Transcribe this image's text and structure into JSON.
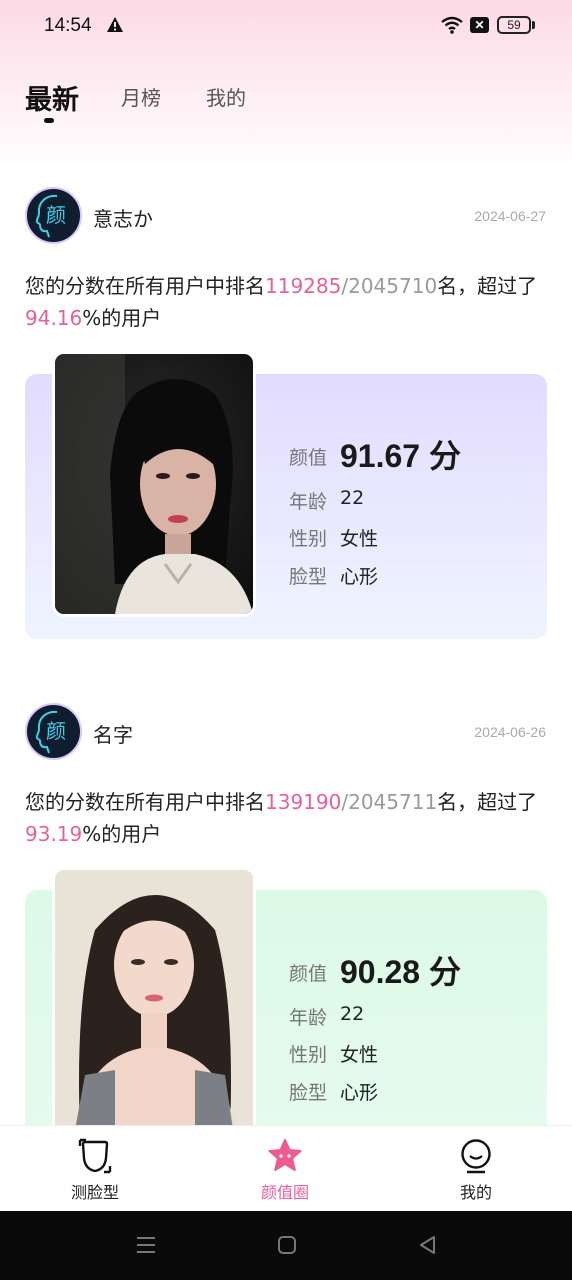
{
  "status_bar": {
    "time": "14:54",
    "battery": "59"
  },
  "tabs": [
    {
      "label": "最新",
      "active": true
    },
    {
      "label": "月榜",
      "active": false
    },
    {
      "label": "我的",
      "active": false
    }
  ],
  "posts": [
    {
      "avatar_text": "颜",
      "username": "意志か",
      "date": "2024-06-27",
      "rank_prefix": "您的分数在所有用户中排名",
      "rank": "119285",
      "slash": "/",
      "total": "2045710",
      "rank_mid": "名，超过了",
      "percent": "94.16",
      "rank_suffix": "%的用户",
      "score_label": "颜值",
      "score": "91.67",
      "score_unit": "分",
      "age_label": "年龄",
      "age": "22",
      "gender_label": "性别",
      "gender": "女性",
      "face_label": "脸型",
      "face": "心形"
    },
    {
      "avatar_text": "颜",
      "username": "名字",
      "date": "2024-06-26",
      "rank_prefix": "您的分数在所有用户中排名",
      "rank": "139190",
      "slash": "/",
      "total": "2045711",
      "rank_mid": "名，超过了",
      "percent": "93.19",
      "rank_suffix": "%的用户",
      "score_label": "颜值",
      "score": "90.28",
      "score_unit": "分",
      "age_label": "年龄",
      "age": "22",
      "gender_label": "性别",
      "gender": "女性",
      "face_label": "脸型",
      "face": "心形"
    }
  ],
  "bottom_nav": [
    {
      "label": "测脸型",
      "icon": "face-scan-icon",
      "active": false
    },
    {
      "label": "颜值圈",
      "icon": "star-face-icon",
      "active": true
    },
    {
      "label": "我的",
      "icon": "smile-profile-icon",
      "active": false
    }
  ],
  "colors": {
    "accent": "#e8609a",
    "header_gradient": "#fdd9e6"
  }
}
